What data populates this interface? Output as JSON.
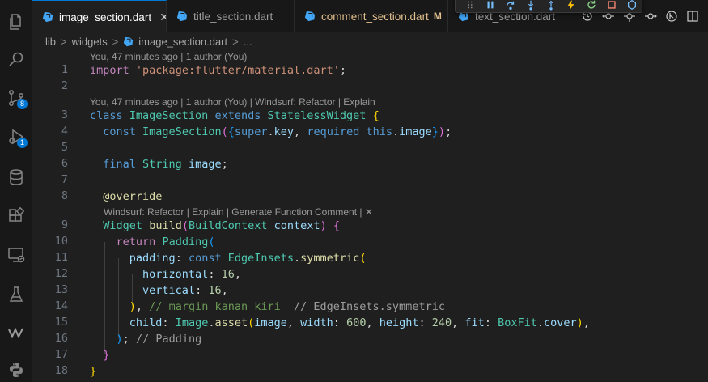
{
  "tabs": [
    {
      "label": "image_section.dart",
      "active": true,
      "close": "✕"
    },
    {
      "label": "title_section.dart",
      "active": false
    },
    {
      "label": "comment_section.dart",
      "active": false,
      "modified_mark": "M"
    },
    {
      "label": "text_section.dart",
      "active": false
    }
  ],
  "activity": {
    "scm_badge": "8",
    "debug_badge": "1"
  },
  "breadcrumb": {
    "parts": [
      "lib",
      "widgets",
      "image_section.dart",
      "..."
    ],
    "sep": ">"
  },
  "codelens": {
    "lens1": "You, 47 minutes ago | 1 author (You)",
    "lens2": "You, 47 minutes ago | 1 author (You) | Windsurf: Refactor | Explain",
    "lens3": "Windsurf: Refactor | Explain | Generate Function Comment | ✕"
  },
  "line_numbers": [
    "1",
    "2",
    "3",
    "4",
    "5",
    "6",
    "7",
    "8",
    "9",
    "10",
    "11",
    "12",
    "13",
    "14",
    "15",
    "16",
    "17",
    "18"
  ],
  "code": {
    "l1": {
      "kw": "import",
      "str": "'package:flutter/material.dart'",
      "end": ";"
    },
    "l3": {
      "kw1": "class",
      "name": "ImageSection",
      "kw2": "extends",
      "base": "StatelessWidget",
      "brace": "{"
    },
    "l4": {
      "kw": "const",
      "name": "ImageSection",
      "p1": "(",
      "p2": "{",
      "kw_super": "super",
      "dot": ".",
      "key": "key",
      "comma": ", ",
      "kw_req": "required",
      "kw_this": "this",
      "dot2": ".",
      "image": "image",
      "p3": "}",
      "p4": ")",
      "end": ";"
    },
    "l6": {
      "kw": "final",
      "type": "String",
      "var": "image",
      "end": ";"
    },
    "l8": {
      "ann": "@override"
    },
    "l9": {
      "type": "Widget",
      "fn": "build",
      "p1": "(",
      "ptype": "BuildContext",
      "pname": "context",
      "p2": ")",
      "brace": "{"
    },
    "l10": {
      "kw": "return",
      "cls": "Padding",
      "p": "("
    },
    "l11": {
      "prop": "padding",
      "colon": ": ",
      "kw": "const",
      "cls": "EdgeInsets",
      "dot": ".",
      "fn": "symmetric",
      "p": "("
    },
    "l12": {
      "prop": "horizontal",
      "colon": ": ",
      "num": "16",
      "comma": ","
    },
    "l13": {
      "prop": "vertical",
      "colon": ": ",
      "num": "16",
      "comma": ","
    },
    "l14": {
      "p": ")",
      "comma": ", ",
      "cmt": "// margin kanan kiri",
      "hint": "// EdgeInsets.symmetric"
    },
    "l15": {
      "prop": "child",
      "colon": ": ",
      "cls": "Image",
      "dot": ".",
      "fn": "asset",
      "p1": "(",
      "a1": "image",
      "c1": ", ",
      "n1": "width",
      "col1": ": ",
      "v1": "600",
      "c2": ", ",
      "n2": "height",
      "col2": ": ",
      "v2": "240",
      "c3": ", ",
      "n3": "fit",
      "col3": ": ",
      "fitcls": "BoxFit",
      "dot2": ".",
      "fitval": "cover",
      "p2": ")",
      "comma": ","
    },
    "l16": {
      "p": ")",
      "end": ";",
      "hint": "// Padding"
    },
    "l17": {
      "brace": "}"
    },
    "l18": {
      "brace": "}"
    }
  },
  "colors": {
    "accent": "#0078d4",
    "editor_bg": "#1f1f1f",
    "dart_icon": "#42a5f5",
    "modified": "#e2c08d"
  },
  "icons": {
    "activity": [
      "files-icon",
      "search-icon",
      "source-control-icon",
      "run-debug-icon",
      "database-icon",
      "extensions-icon",
      "remote-explorer-icon",
      "testing-icon",
      "windsurf-icon",
      "python-icon"
    ],
    "debug_toolbar": [
      "drag-handle-icon",
      "pause-icon",
      "step-over-icon",
      "step-into-icon",
      "step-out-icon",
      "hot-reload-icon",
      "restart-icon",
      "stop-icon",
      "devtools-icon"
    ],
    "tab_actions": [
      "timeline-icon",
      "go-back-icon",
      "compare-icon",
      "go-forward-icon",
      "open-changes-icon",
      "split-editor-icon"
    ]
  }
}
